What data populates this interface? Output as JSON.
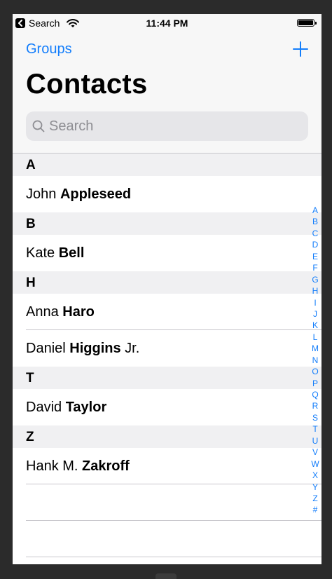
{
  "status_bar": {
    "back_app": "Search",
    "time": "11:44 PM"
  },
  "nav": {
    "back_label": "Groups",
    "title": "Contacts",
    "add_icon": "plus-icon"
  },
  "search": {
    "placeholder": "Search",
    "value": ""
  },
  "sections": [
    {
      "letter": "A",
      "contacts": [
        {
          "first": "John",
          "last": "Appleseed",
          "suffix": ""
        }
      ]
    },
    {
      "letter": "B",
      "contacts": [
        {
          "first": "Kate",
          "last": "Bell",
          "suffix": ""
        }
      ]
    },
    {
      "letter": "H",
      "contacts": [
        {
          "first": "Anna",
          "last": "Haro",
          "suffix": ""
        },
        {
          "first": "Daniel",
          "last": "Higgins",
          "suffix": "Jr."
        }
      ]
    },
    {
      "letter": "T",
      "contacts": [
        {
          "first": "David",
          "last": "Taylor",
          "suffix": ""
        }
      ]
    },
    {
      "letter": "Z",
      "contacts": [
        {
          "first": "Hank M.",
          "last": "Zakroff",
          "suffix": ""
        }
      ]
    }
  ],
  "index": [
    "A",
    "B",
    "C",
    "D",
    "E",
    "F",
    "G",
    "H",
    "I",
    "J",
    "K",
    "L",
    "M",
    "N",
    "O",
    "P",
    "Q",
    "R",
    "S",
    "T",
    "U",
    "V",
    "W",
    "X",
    "Y",
    "Z",
    "#"
  ],
  "colors": {
    "accent": "#147efb",
    "section_bg": "#f0f0f2",
    "nav_bg": "#f7f7f7",
    "search_bg": "#e6e6e9"
  }
}
